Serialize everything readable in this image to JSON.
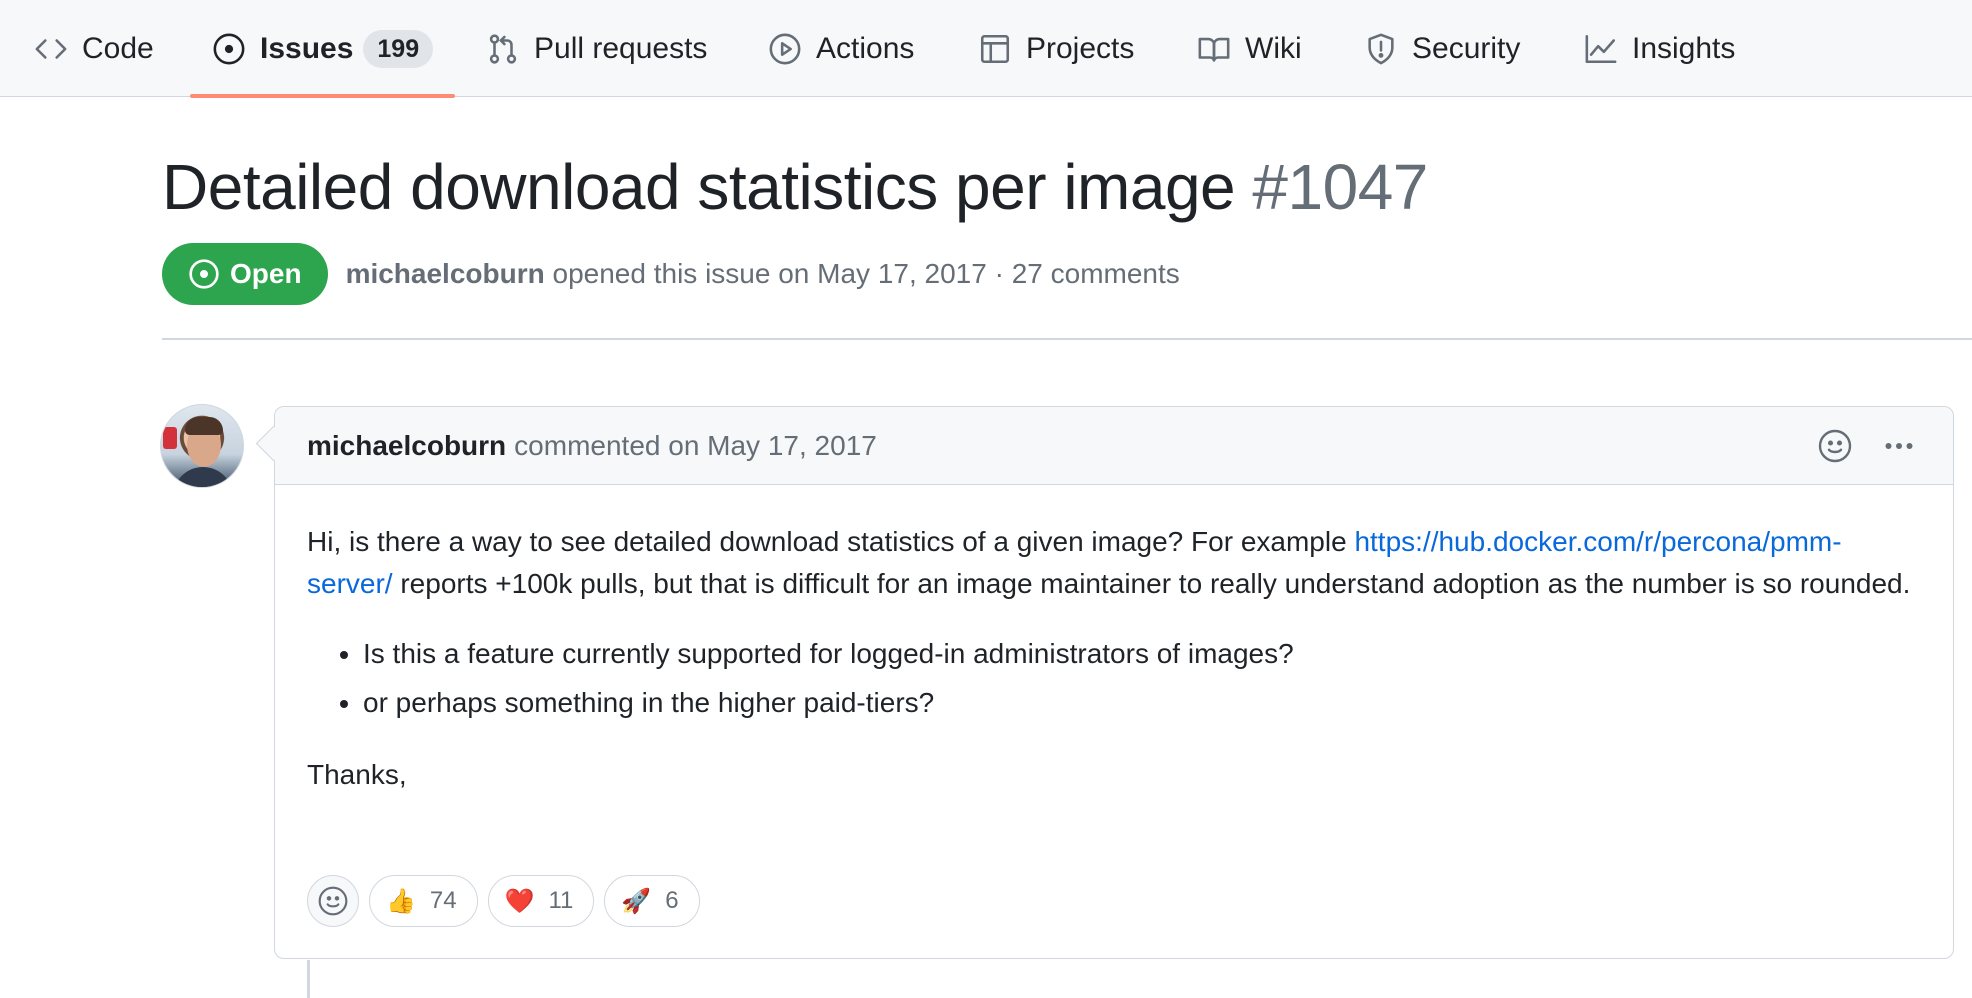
{
  "nav": {
    "tabs": [
      {
        "label": "Code",
        "icon": "code-icon"
      },
      {
        "label": "Issues",
        "icon": "issue-opened-icon",
        "count": "199",
        "active": true
      },
      {
        "label": "Pull requests",
        "icon": "git-pull-request-icon"
      },
      {
        "label": "Actions",
        "icon": "play-icon"
      },
      {
        "label": "Projects",
        "icon": "table-icon"
      },
      {
        "label": "Wiki",
        "icon": "book-icon"
      },
      {
        "label": "Security",
        "icon": "shield-icon"
      },
      {
        "label": "Insights",
        "icon": "graph-icon"
      }
    ]
  },
  "issue": {
    "title": "Detailed download statistics per image",
    "number": "#1047",
    "state": "Open",
    "author": "michaelcoburn",
    "opened_text": "opened this issue on May 17, 2017 · 27 comments"
  },
  "comment": {
    "author": "michaelcoburn",
    "action_text": "commented on May 17, 2017",
    "body_intro": "Hi, is there a way to see detailed download statistics of a given image? For example ",
    "link_text": "https://hub.docker.com/r/percona/pmm-server/",
    "body_rest": " reports +100k pulls, but that is difficult for an image maintainer to really understand adoption as the number is so rounded.",
    "bullets": [
      "Is this a feature currently supported for logged-in administrators of images?",
      "or perhaps something in the higher paid-tiers?"
    ],
    "closing": "Thanks,",
    "reactions": [
      {
        "emoji": "👍",
        "count": "74"
      },
      {
        "emoji": "❤️",
        "count": "11"
      },
      {
        "emoji": "🚀",
        "count": "6"
      }
    ]
  },
  "colors": {
    "open_green": "#2da44e",
    "active_tab_underline": "#fd8c73",
    "link_blue": "#0969da"
  }
}
